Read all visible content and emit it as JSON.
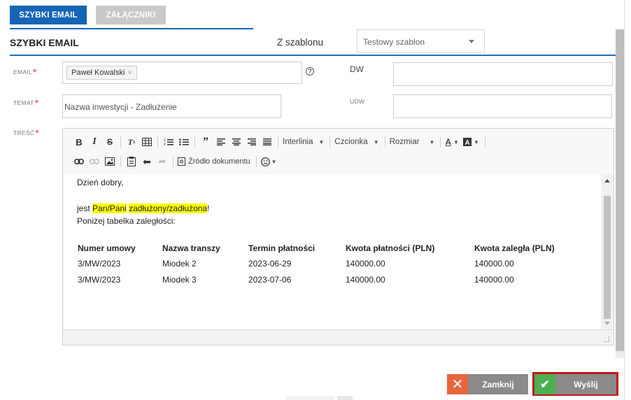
{
  "tabs": [
    {
      "label": "SZYBKI EMAIL",
      "active": true
    },
    {
      "label": "ZAŁĄCZNIKI",
      "active": false
    }
  ],
  "header": {
    "title": "SZYBKI EMAIL",
    "template_label": "Z szablonu",
    "template_value": "Testowy szablon"
  },
  "fields": {
    "email_label": "EMAIL",
    "email_chip": "Paweł Kowalski",
    "dw_label": "DW",
    "dw_value": "",
    "temat_label": "TEMAT",
    "temat_value": "Nazwa inwestycji - Zadłużenie",
    "udw_label": "UDW",
    "udw_value": "",
    "tresc_label": "TREŚĆ",
    "required_mark": "*"
  },
  "toolbar": {
    "bold": "B",
    "italic": "I",
    "strike": "S",
    "line_height": "Interlinia",
    "font": "Czcionka",
    "size": "Rozmiar",
    "text_color": "A",
    "source": "Źródło dokumentu"
  },
  "content": {
    "greeting": "Dzień dobry,",
    "line2_prefix": "jest ",
    "line2_hl1": "Pan/Pani",
    "line2_space": " ",
    "line2_hl2": "zadłużony/zadłużona",
    "line2_suffix": "!",
    "line3": "Poniżej tabelka zaległości:",
    "table": {
      "headers": [
        "Numer umowy",
        "Nazwa transzy",
        "Termin płatności",
        "Kwota płatności (PLN)",
        "Kwota zaległa (PLN)"
      ],
      "rows": [
        [
          "3/MW/2023",
          "Miodek 2",
          "2023-06-29",
          "140000.00",
          "140000.00"
        ],
        [
          "3/MW/2023",
          "Miodek 3",
          "2023-07-06",
          "140000.00",
          "140000.00"
        ]
      ]
    }
  },
  "buttons": {
    "close_label": "Zamknij",
    "send_label": "Wyślij"
  },
  "colors": {
    "accent": "#1565b5",
    "required": "#e53935",
    "highlight": "#ffff00",
    "close_icon_bg": "#e8663d",
    "send_icon_bg": "#4caf50",
    "send_outline": "#c4161c"
  }
}
